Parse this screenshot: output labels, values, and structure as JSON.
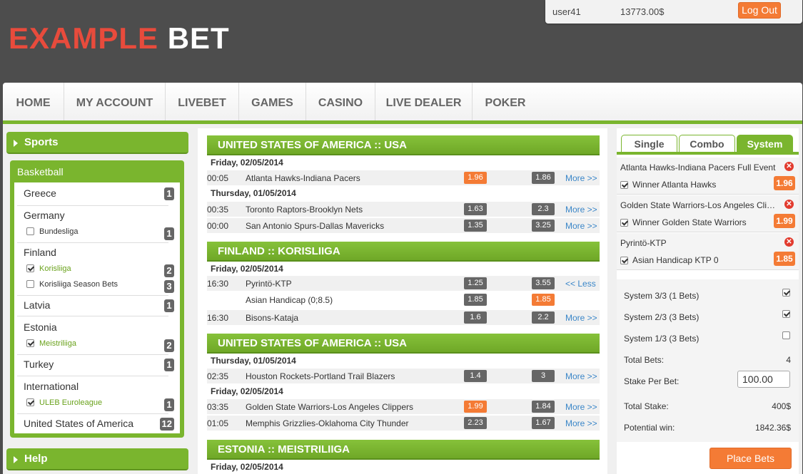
{
  "logo": {
    "part1": "EXAMPLE",
    "part2": "BET"
  },
  "user": {
    "name": "user41",
    "balance": "13773.00$",
    "logout_label": "Log Out"
  },
  "nav": [
    "HOME",
    "MY ACCOUNT",
    "LIVEBET",
    "GAMES",
    "CASINO",
    "LIVE DEALER",
    "POKER"
  ],
  "sidebar": {
    "sports_title": "Sports",
    "help_title": "Help",
    "basketball": {
      "title": "Basketball",
      "items": [
        {
          "label": "Greece",
          "count": "1"
        },
        {
          "label": "Germany"
        },
        {
          "label": "Bundesliga",
          "count": "1",
          "checked": false,
          "sub": true
        },
        {
          "label": "Finland"
        },
        {
          "label": "Korisliiga",
          "count": "2",
          "checked": true,
          "sub": true
        },
        {
          "label": "Korisliiga Season Bets",
          "count": "3",
          "checked": false,
          "sub": true
        },
        {
          "label": "Latvia",
          "count": "1"
        },
        {
          "label": "Estonia"
        },
        {
          "label": "Meistriliiga",
          "count": "2",
          "checked": true,
          "sub": true
        },
        {
          "label": "Turkey",
          "count": "1"
        },
        {
          "label": "International"
        },
        {
          "label": "ULEB Euroleague",
          "count": "1",
          "checked": true,
          "sub": true
        },
        {
          "label": "United States of America",
          "count": "12"
        }
      ]
    }
  },
  "events": [
    {
      "header": "UNITED STATES OF AMERICA :: USA"
    },
    {
      "date": "Friday, 02/05/2014"
    },
    {
      "time": "00:05",
      "match": "Atlanta Hawks-Indiana Pacers",
      "odd1": "1.96",
      "odd2": "1.86",
      "hot1": true,
      "more": "More >>"
    },
    {
      "date": "Thursday, 01/05/2014"
    },
    {
      "time": "00:35",
      "match": "Toronto Raptors-Brooklyn Nets",
      "odd1": "1.63",
      "odd2": "2.3",
      "more": "More >>"
    },
    {
      "time": "00:00",
      "match": "San Antonio Spurs-Dallas Mavericks",
      "odd1": "1.35",
      "odd2": "3.25",
      "more": "More >>"
    },
    {
      "header": "FINLAND :: KORISLIIGA"
    },
    {
      "date": "Friday, 02/05/2014"
    },
    {
      "time": "16:30",
      "match": "Pyrintö-KTP",
      "odd1": "1.25",
      "odd2": "3.55",
      "more": "<< Less"
    },
    {
      "time": "",
      "match": "Asian Handicap (0;8.5)",
      "odd1": "1.85",
      "odd2": "1.85",
      "hot2": true,
      "white": true
    },
    {
      "time": "16:30",
      "match": "Bisons-Kataja",
      "odd1": "1.6",
      "odd2": "2.2",
      "more": "More >>"
    },
    {
      "header": "UNITED STATES OF AMERICA :: USA"
    },
    {
      "date": "Thursday, 01/05/2014"
    },
    {
      "time": "02:35",
      "match": "Houston Rockets-Portland Trail Blazers",
      "odd1": "1.4",
      "odd2": "3",
      "more": "More >>"
    },
    {
      "date": "Friday, 02/05/2014"
    },
    {
      "time": "03:35",
      "match": "Golden State Warriors-Los Angeles Clippers",
      "odd1": "1.99",
      "odd2": "1.84",
      "hot1": true,
      "more": "More >>"
    },
    {
      "time": "01:05",
      "match": "Memphis Grizzlies-Oklahoma City Thunder",
      "odd1": "2.23",
      "odd2": "1.67",
      "more": "More >>"
    },
    {
      "header": "ESTONIA :: MEISTRILIIGA"
    },
    {
      "date": "Friday, 02/05/2014"
    }
  ],
  "betslip": {
    "tabs": [
      {
        "label": "Single"
      },
      {
        "label": "Combo"
      },
      {
        "label": "System",
        "active": true
      }
    ],
    "selections": [
      {
        "event": "Atlanta Hawks-Indiana Pacers Full Event",
        "pick": "Winner  Atlanta Hawks",
        "odd": "1.96"
      },
      {
        "event": "Golden State Warriors-Los Angeles Clippers",
        "pick": "Winner  Golden State Warriors",
        "odd": "1.99"
      },
      {
        "event": "Pyrintö-KTP",
        "pick": "Asian Handicap  KTP 0",
        "odd": "1.85"
      }
    ],
    "systems": [
      {
        "label": "System 3/3 (1 Bets)",
        "checked": true
      },
      {
        "label": "System 2/3 (3 Bets)",
        "checked": true
      },
      {
        "label": "System 1/3 (3 Bets)",
        "checked": false
      }
    ],
    "total_bets_label": "Total Bets:",
    "total_bets": "4",
    "stake_label": "Stake Per Bet:",
    "stake_value": "100.00",
    "total_stake_label": "Total Stake:",
    "total_stake": "400$",
    "potential_label": "Potential win:",
    "potential": "1842.36$",
    "place_label": "Place Bets"
  }
}
